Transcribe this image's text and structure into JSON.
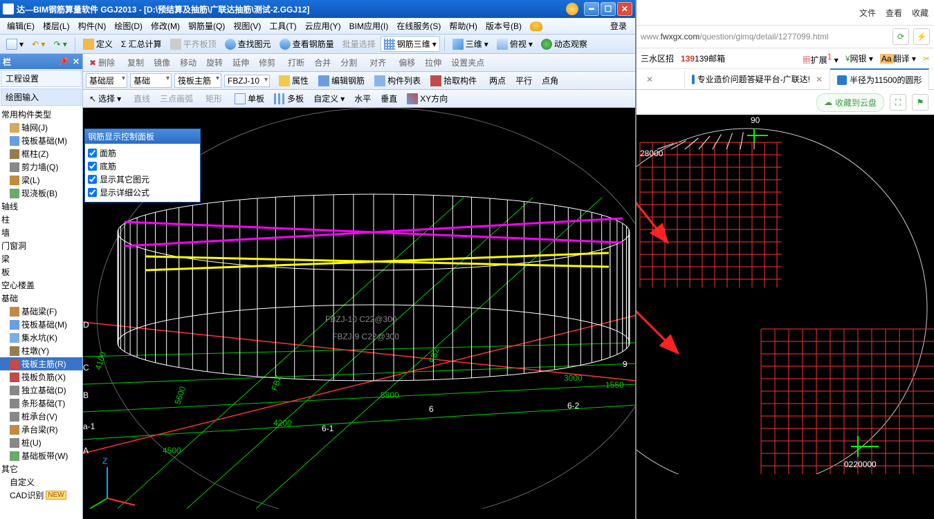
{
  "title": "达—BIM钢筋算量软件 GGJ2013 - [D:\\预结算及抽筋\\广联达抽筋\\测试-2.GGJ12]",
  "menus": [
    "编辑(E)",
    "楼层(L)",
    "构件(N)",
    "绘图(D)",
    "修改(M)",
    "钢筋量(Q)",
    "视图(V)",
    "工具(T)",
    "云应用(Y)",
    "BIM应用(I)",
    "在线服务(S)",
    "帮助(H)",
    "版本号(B)"
  ],
  "login": "登录",
  "toolbar1": {
    "define": "定义",
    "sum": "Σ 汇总计算",
    "flatroof": "平齐板顶",
    "findelem": "查找图元",
    "viewrebar": "查看钢筋量",
    "batchsel": "批量选择",
    "view3d": "钢筋三维",
    "threed": "三维",
    "perspective": "俯视",
    "dynview": "动态观察"
  },
  "toolbar2": {
    "delete": "删除",
    "copy": "复制",
    "mirror": "镜像",
    "move": "移动",
    "rotate": "旋转",
    "extend": "延伸",
    "trim": "修剪",
    "break": "打断",
    "merge": "合并",
    "split": "分割",
    "align": "对齐",
    "offset": "偏移",
    "snap": "拉伸",
    "setsnap": "设置夹点"
  },
  "toolbar3": {
    "floorcombo": "基础层",
    "membercombo": "基础",
    "rebarcombo": "筏板主筋",
    "codecombo": "FBZJ-10",
    "attr": "属性",
    "editrebar": "编辑钢筋",
    "memberlist": "构件列表",
    "pick": "拾取构件",
    "twopt": "两点",
    "parallel": "平行",
    "ptangle": "点角"
  },
  "toolbar4": {
    "select": "选择",
    "line": "直线",
    "arc3": "三点画弧",
    "rect": "矩形",
    "single": "单板",
    "multi": "多板",
    "custom": "自定义",
    "horiz": "水平",
    "vert": "垂直",
    "xydir": "XY方向"
  },
  "sidebar": {
    "title": "栏",
    "cat1": "工程设置",
    "cat2": "绘图输入",
    "groups": {
      "common": "常用构件类型",
      "axis": "轴线",
      "column": "柱",
      "wall": "墙",
      "opening": "门窗洞",
      "beam": "梁",
      "slab": "板",
      "hollow": "空心楼盖",
      "foundation": "基础",
      "other": "其它"
    },
    "items": {
      "axisnet": "轴网(J)",
      "raft": "筏板基础(M)",
      "framecol": "框柱(Z)",
      "shearwall": "剪力墙(Q)",
      "beam": "梁(L)",
      "castslab": "现浇板(B)",
      "fbeam": "基础梁(F)",
      "raft2": "筏板基础(M)",
      "sump": "集水坑(K)",
      "pilecap": "柱墩(Y)",
      "raftmain": "筏板主筋(R)",
      "raftneg": "筏板负筋(X)",
      "isolated": "独立基础(D)",
      "strip": "条形基础(T)",
      "pilecap2": "桩承台(V)",
      "capbeam": "承台梁(R)",
      "pile": "桩(U)",
      "fslab": "基础板带(W)",
      "custom": "自定义",
      "cad": "CAD识别"
    }
  },
  "floatpanel": {
    "title": "钢筋显示控制面板",
    "items": [
      "面筋",
      "底筋",
      "显示其它图元",
      "显示详细公式"
    ]
  },
  "viewport": {
    "labels": {
      "fbz": "FBZ",
      "dim5800": "5800",
      "dim4200": "4200",
      "dim4500": "4500",
      "dim5600": "5600",
      "dim4100": "4100",
      "dim3000": "3000",
      "dim1550": "1550",
      "g6": "6",
      "g61": "6-1",
      "g62": "6-2",
      "g9": "9",
      "ga": "A",
      "gb": "B",
      "gc": "C",
      "gd": "D",
      "ga1": "a-1",
      "axZ": "Z",
      "annot1": "FBZJ-10 C22@300",
      "annot2": "FBZJ-9 C22@300"
    }
  },
  "browser": {
    "topmenu": [
      "文件",
      "查看",
      "收藏"
    ],
    "url_prefix": "www.",
    "url_host": "fwxgx.com",
    "url_path": "/question/gimq/detail/1277099.html",
    "bookmarks": {
      "sanshui": "三水区招",
      "mail": "139邮箱",
      "ext": "扩展",
      "wangyin": "网银",
      "translate": "翻译"
    },
    "tabs": [
      {
        "icon": "favicon",
        "label": "专业造价问题答疑平台-广联达!"
      },
      {
        "icon": "favicon",
        "label": "半径为11500的圆形"
      }
    ],
    "cloudsave": "收藏到云盘",
    "cad_labels": {
      "n90": "90",
      "d28000": "28000",
      "d220000": "0220000"
    }
  }
}
